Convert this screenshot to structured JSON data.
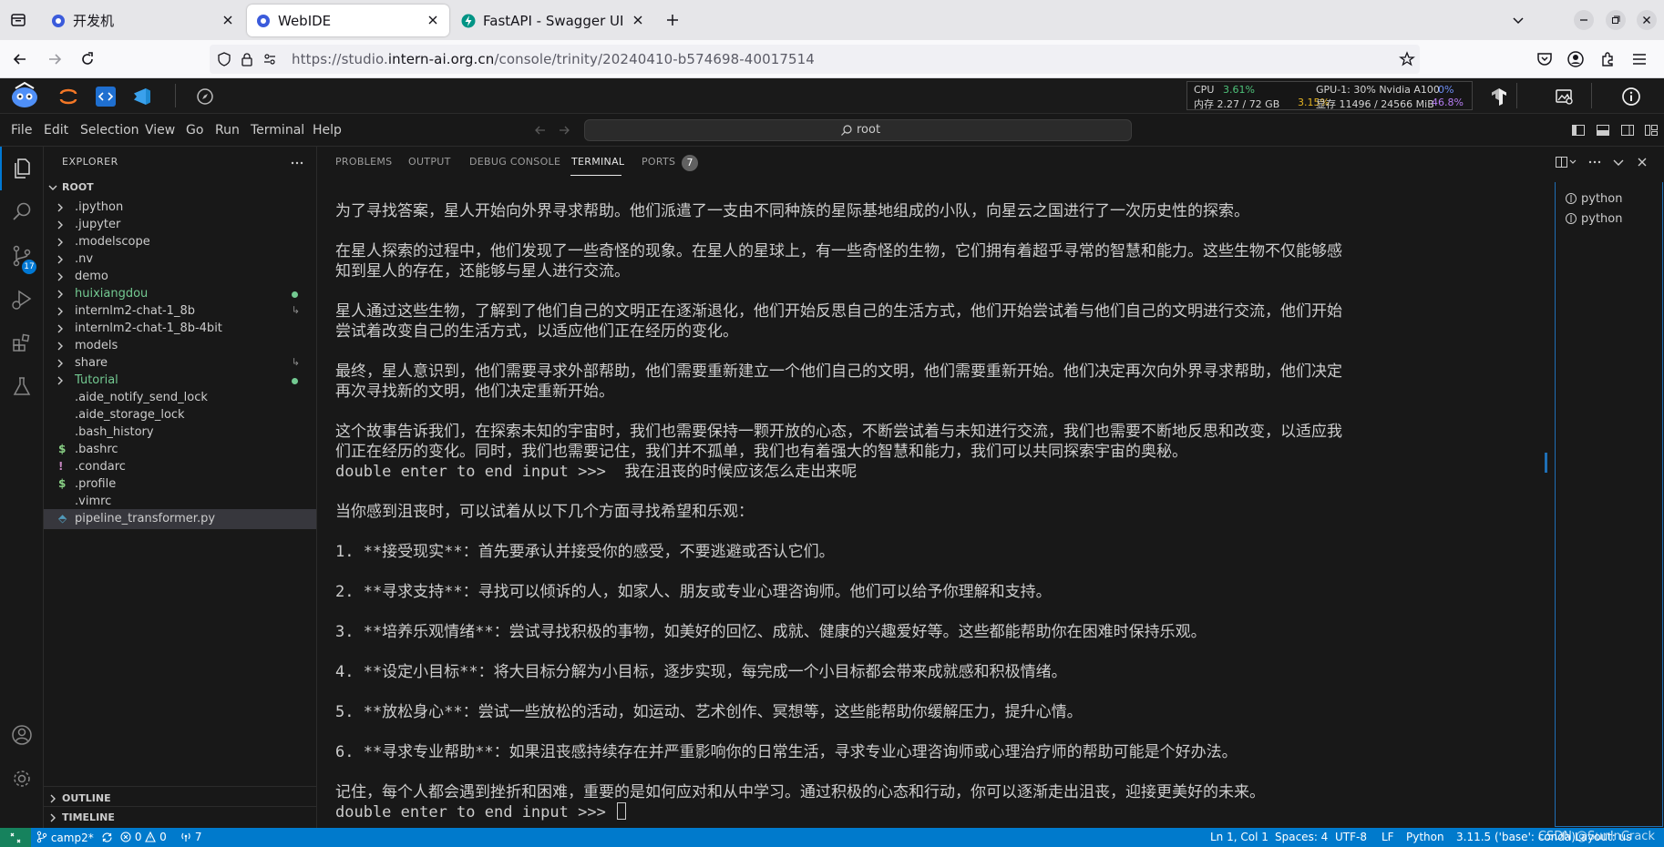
{
  "browser": {
    "tabs": [
      {
        "title": "开发机",
        "active": false
      },
      {
        "title": "WebIDE",
        "active": true
      },
      {
        "title": "FastAPI - Swagger UI",
        "active": false
      }
    ],
    "url": {
      "scheme_prefix": "https://studio.",
      "domain": "intern-ai.org.cn",
      "path": "/console/trinity/20240410-b574698-40017514"
    }
  },
  "studio": {
    "stats": {
      "cpu_label": "CPU",
      "cpu_value": "3.61%",
      "mem_label": "内存 2.27 / 72 GB",
      "mem_value": "3.15%",
      "gpu_label": "GPU-1: 30% Nvidia A100",
      "gpu_value": "0%",
      "vram_label": "显存 11496 / 24566 MiB",
      "vram_value": "46.8%"
    }
  },
  "menu": [
    "File",
    "Edit",
    "Selection",
    "View",
    "Go",
    "Run",
    "Terminal",
    "Help"
  ],
  "command_center": "root",
  "activity": {
    "scm_badge": "17"
  },
  "explorer": {
    "title": "EXPLORER",
    "root": "ROOT",
    "items": [
      {
        "name": ".ipython",
        "type": "folder"
      },
      {
        "name": ".jupyter",
        "type": "folder"
      },
      {
        "name": ".modelscope",
        "type": "folder"
      },
      {
        "name": ".nv",
        "type": "folder"
      },
      {
        "name": "demo",
        "type": "folder"
      },
      {
        "name": "huixiangdou",
        "type": "folder"
      },
      {
        "name": "internlm2-chat-1_8b",
        "type": "folder"
      },
      {
        "name": "internlm2-chat-1_8b-4bit",
        "type": "folder"
      },
      {
        "name": "models",
        "type": "folder"
      },
      {
        "name": "share",
        "type": "folder"
      },
      {
        "name": "Tutorial",
        "type": "folder"
      },
      {
        "name": ".aide_notify_send_lock",
        "type": "file"
      },
      {
        "name": ".aide_storage_lock",
        "type": "file"
      },
      {
        "name": ".bash_history",
        "type": "file"
      },
      {
        "name": ".bashrc",
        "type": "file",
        "icon": "$"
      },
      {
        "name": ".condarc",
        "type": "file",
        "icon": "!"
      },
      {
        "name": ".profile",
        "type": "file",
        "icon": "$"
      },
      {
        "name": ".vimrc",
        "type": "file"
      },
      {
        "name": "pipeline_transformer.py",
        "type": "file",
        "icon": "py"
      }
    ],
    "outline": "OUTLINE",
    "timeline": "TIMELINE"
  },
  "panel": {
    "tabs": [
      "PROBLEMS",
      "OUTPUT",
      "DEBUG CONSOLE",
      "TERMINAL",
      "PORTS"
    ],
    "ports_badge": "7",
    "terminal_list": [
      "python",
      "python"
    ],
    "terminal_lines": [
      "为了寻找答案，星人开始向外界寻求帮助。他们派遣了一支由不同种族的星际基地组成的小队，向星云之国进行了一次历史性的探索。",
      "",
      "在星人探索的过程中，他们发现了一些奇怪的现象。在星人的星球上，有一些奇怪的生物，它们拥有着超乎寻常的智慧和能力。这些生物不仅能够感",
      "知到星人的存在，还能够与星人进行交流。",
      "",
      "星人通过这些生物，了解到了他们自己的文明正在逐渐退化，他们开始反思自己的生活方式，他们开始尝试着与他们自己的文明进行交流，他们开始",
      "尝试着改变自己的生活方式，以适应他们正在经历的变化。",
      "",
      "最终，星人意识到，他们需要寻求外部帮助，他们需要重新建立一个他们自己的文明，他们需要重新开始。他们决定再次向外界寻求帮助，他们决定",
      "再次寻找新的文明，他们决定重新开始。",
      "",
      "这个故事告诉我们，在探索未知的宇宙时，我们也需要保持一颗开放的心态，不断尝试着与未知进行交流，我们也需要不断地反思和改变，以适应我",
      "们正在经历的变化。同时，我们也需要记住，我们并不孤单，我们也有着强大的智慧和能力，我们可以共同探索宇宙的奥秘。",
      "double enter to end input >>>  我在沮丧的时候应该怎么走出来呢",
      "",
      "当你感到沮丧时，可以试着从以下几个方面寻找希望和乐观：",
      "",
      "1. **接受现实**：首先要承认并接受你的感受，不要逃避或否认它们。",
      "",
      "2. **寻求支持**：寻找可以倾诉的人，如家人、朋友或专业心理咨询师。他们可以给予你理解和支持。",
      "",
      "3. **培养乐观情绪**：尝试寻找积极的事物，如美好的回忆、成就、健康的兴趣爱好等。这些都能帮助你在困难时保持乐观。",
      "",
      "4. **设定小目标**：将大目标分解为小目标，逐步实现，每完成一个小目标都会带来成就感和积极情绪。",
      "",
      "5. **放松身心**：尝试一些放松的活动，如运动、艺术创作、冥想等，这些能帮助你缓解压力，提升心情。",
      "",
      "6. **寻求专业帮助**：如果沮丧感持续存在并严重影响你的日常生活，寻求专业心理咨询师或心理治疗师的帮助可能是个好办法。",
      "",
      "记住，每个人都会遇到挫折和困难，重要的是如何应对和从中学习。通过积极的心态和行动，你可以逐渐走出沮丧，迎接更美好的未来。",
      "double enter to end input >>> "
    ]
  },
  "statusbar": {
    "branch": "camp2*",
    "errors": "0",
    "warnings": "0",
    "ports": "7",
    "position": "Ln 1, Col 1",
    "spaces": "Spaces: 4",
    "encoding": "UTF-8",
    "eol": "LF",
    "language": "Python",
    "interpreter": "3.11.5 ('base': conda)",
    "layout": "Layout: us",
    "watermark": "CSDN @SunInCrack"
  },
  "colors": {
    "accent": "#007acc",
    "git_modified": "#73c991",
    "folder_green": "#73c991"
  }
}
